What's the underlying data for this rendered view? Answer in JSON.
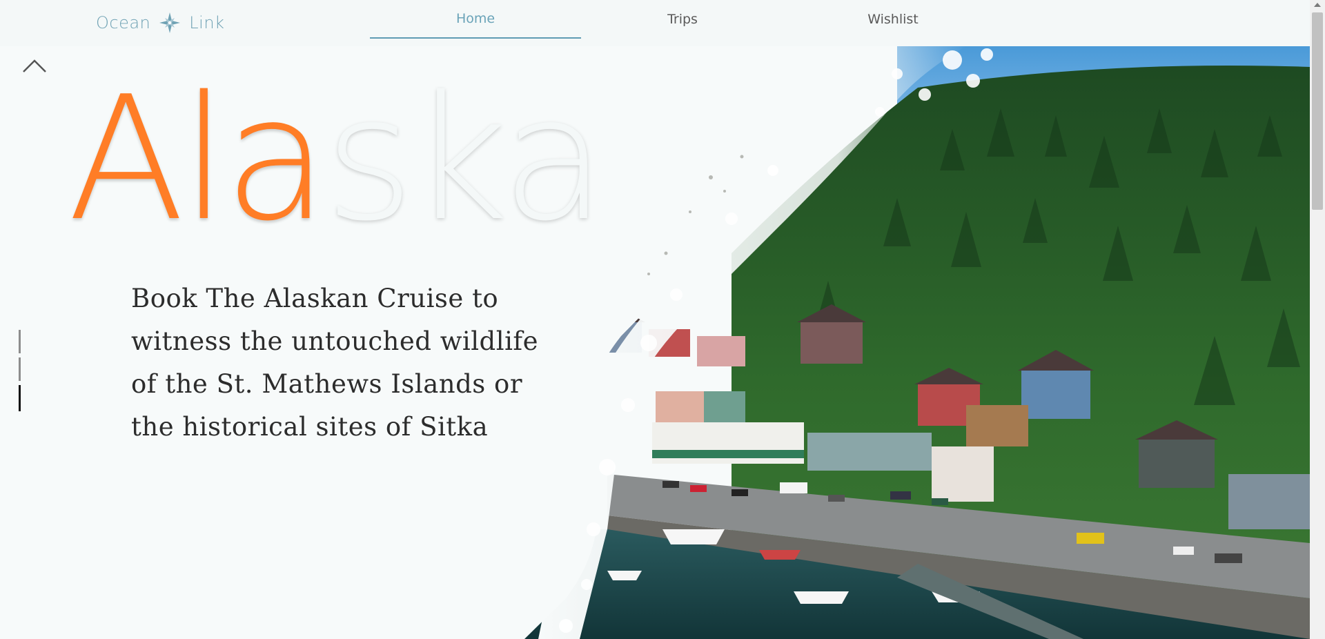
{
  "brand": {
    "left": "Ocean",
    "right": "Link",
    "icon": "compass-star-icon"
  },
  "nav": [
    {
      "label": "Home",
      "active": true
    },
    {
      "label": "Trips",
      "active": false
    },
    {
      "label": "Wishlist",
      "active": false
    }
  ],
  "hero": {
    "title_part1": "Ala",
    "title_part2": "ska",
    "description": "Book The Alaskan Cruise to witness the untouched wildlife of the St. Mathews Islands or the historical sites of Sitka",
    "slides": {
      "count": 3,
      "active_index": 2
    }
  },
  "colors": {
    "accent_orange": "#ff7d26",
    "nav_blue": "#5e9bb3",
    "brand_blue": "#6fa2b4"
  }
}
